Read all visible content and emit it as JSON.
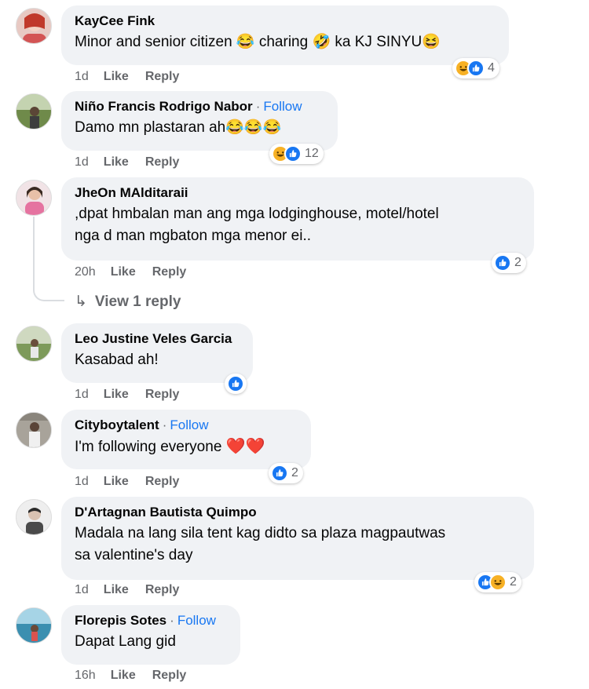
{
  "comments": [
    {
      "name": "KayCee Fink",
      "follow": "",
      "text": "Minor and senior citizen 😂 charing 🤣 ka KJ SINYU😆",
      "time": "1d",
      "like": "Like",
      "reply": "Reply",
      "reaction_count": "4",
      "reactions": [
        "haha-icon",
        "like-icon"
      ]
    },
    {
      "name": "Niño Francis Rodrigo Nabor",
      "follow": "Follow",
      "text": "Damo mn plastaran ah😂😂😂",
      "time": "1d",
      "like": "Like",
      "reply": "Reply",
      "reaction_count": "12",
      "reactions": [
        "haha-icon",
        "like-icon"
      ]
    },
    {
      "name": "JheOn MAlditaraii",
      "follow": "",
      "text_line1": ",dpat hmbalan man ang mga lodginghouse, motel/hotel",
      "text_line2": "nga d man mgbaton mga menor ei..",
      "time": "20h",
      "like": "Like",
      "reply": "Reply",
      "reaction_count": "2",
      "reactions": [
        "like-icon"
      ],
      "view_replies": "View 1 reply"
    },
    {
      "name": "Leo Justine Veles Garcia",
      "follow": "",
      "text": "Kasabad ah!",
      "time": "1d",
      "like": "Like",
      "reply": "Reply",
      "reaction_count": "",
      "reactions": [
        "like-icon"
      ]
    },
    {
      "name": "Cityboytalent",
      "follow": "Follow",
      "text": "I'm following everyone ",
      "hearts": "❤️❤️",
      "time": "1d",
      "like": "Like",
      "reply": "Reply",
      "reaction_count": "2",
      "reactions": [
        "like-icon"
      ]
    },
    {
      "name": "D'Artagnan Bautista Quimpo",
      "follow": "",
      "text_line1": "Madala na lang sila tent kag didto sa plaza magpautwas",
      "text_line2": "sa valentine's day",
      "time": "1d",
      "like": "Like",
      "reply": "Reply",
      "reaction_count": "2",
      "reactions": [
        "like-icon",
        "haha-icon"
      ]
    },
    {
      "name": "Florepis Sotes",
      "follow": "Follow",
      "text": "Dapat Lang gid",
      "time": "16h",
      "like": "Like",
      "reply": "Reply",
      "reaction_count": "",
      "reactions": []
    }
  ],
  "separator": "·",
  "colors": {
    "link_blue": "#1877f2",
    "bubble_bg": "#f0f2f5",
    "muted": "#65676b"
  }
}
